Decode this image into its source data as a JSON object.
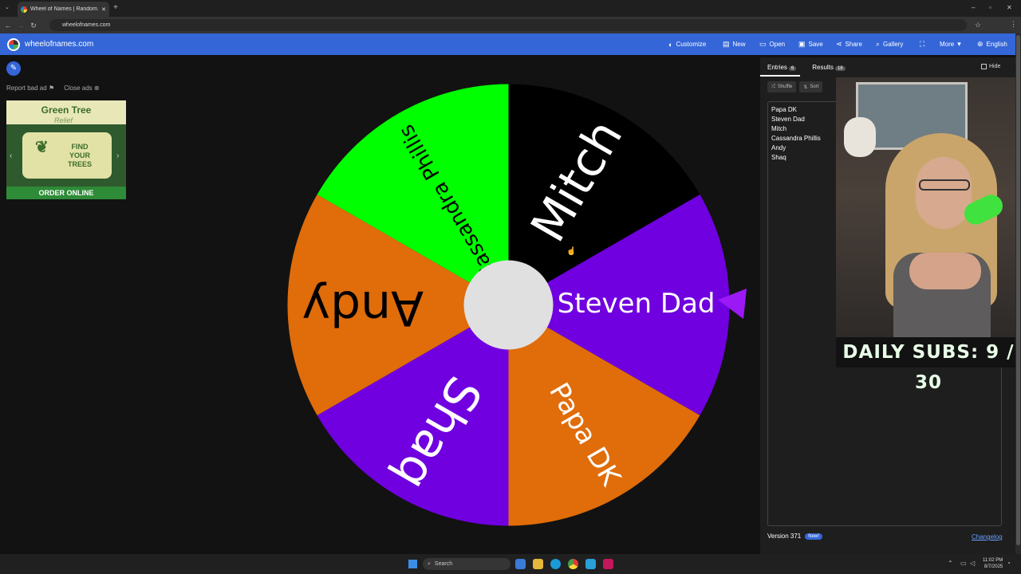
{
  "browser": {
    "tab_title": "Wheel of Names | Random...",
    "url": "wheelofnames.com"
  },
  "app": {
    "site_name": "wheelofnames.com",
    "menu": [
      {
        "label": "Customize",
        "icon": "palette-icon"
      },
      {
        "label": "New",
        "icon": "file-icon"
      },
      {
        "label": "Open",
        "icon": "folder-icon"
      },
      {
        "label": "Save",
        "icon": "save-icon"
      },
      {
        "label": "Share",
        "icon": "share-icon"
      },
      {
        "label": "Gallery",
        "icon": "search-icon"
      },
      {
        "label": "",
        "icon": "fullscreen-icon"
      },
      {
        "label": "More",
        "icon": "chevron-down-icon"
      },
      {
        "label": "English",
        "icon": "globe-icon"
      }
    ]
  },
  "ads": {
    "report": "Report bad ad",
    "close": "Close ads",
    "brand": "Green Tree",
    "brand_sub": "Relief",
    "cta": "FIND YOUR TREES",
    "bottom": "ORDER ONLINE"
  },
  "wheel": {
    "segments": [
      {
        "label": "Steven Dad",
        "color": "#7000e0"
      },
      {
        "label": "Papa DK",
        "color": "#e06c0a"
      },
      {
        "label": "Shaq",
        "color": "#7000e0"
      },
      {
        "label": "Andy",
        "color": "#e06c0a"
      },
      {
        "label": "Cassandra Phillis",
        "color": "#00ff00"
      },
      {
        "label": "Mitch",
        "color": "#000000"
      }
    ],
    "pointer_color": "#9b19f5"
  },
  "panel": {
    "tab_entries": "Entries",
    "entries_count": "6",
    "tab_results": "Results",
    "results_count": "18",
    "hide": "Hide",
    "shuffle": "Shuffle",
    "sort": "Sort",
    "entries": [
      "Papa DK",
      "Steven Dad",
      "Mitch",
      "Cassandra Phillis",
      "Andy",
      "Shaq"
    ],
    "version": "Version 371",
    "new_badge": "New!",
    "changelog": "Changelog"
  },
  "overlay": {
    "daily_subs": "DAILY SUBS:  9 / 30"
  },
  "taskbar": {
    "search": "Search",
    "time": "11:02 PM",
    "date": "8/7/2025"
  }
}
